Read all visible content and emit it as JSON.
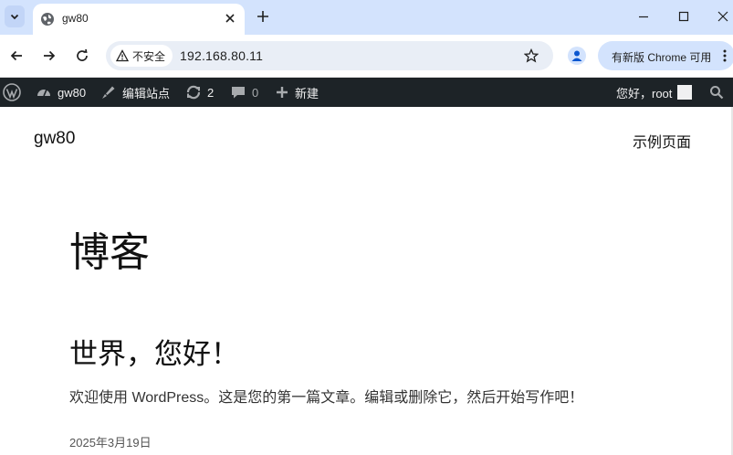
{
  "browser": {
    "tab": {
      "title": "gw80"
    },
    "address_bar": {
      "security_label": "不安全",
      "url": "192.168.80.11"
    },
    "update_chip": {
      "label": "有新版 Chrome 可用"
    }
  },
  "admin_bar": {
    "site_name": "gw80",
    "edit_site": "编辑站点",
    "updates_count": "2",
    "comments_count": "0",
    "new_label": "新建",
    "greeting": "您好，root"
  },
  "site": {
    "title": "gw80",
    "nav": [
      "示例页面"
    ]
  },
  "content": {
    "heading": "博客",
    "post": {
      "title": "世界，您好！",
      "excerpt": "欢迎使用 WordPress。这是您的第一篇文章。编辑或删除它，然后开始写作吧！",
      "date": "2025年3月19日"
    }
  },
  "colors": {
    "tabstrip": "#d3e3fd",
    "omnibox": "#e9eef6",
    "adminbar": "#1d2327",
    "adminbar_text": "#f0f0f1"
  }
}
